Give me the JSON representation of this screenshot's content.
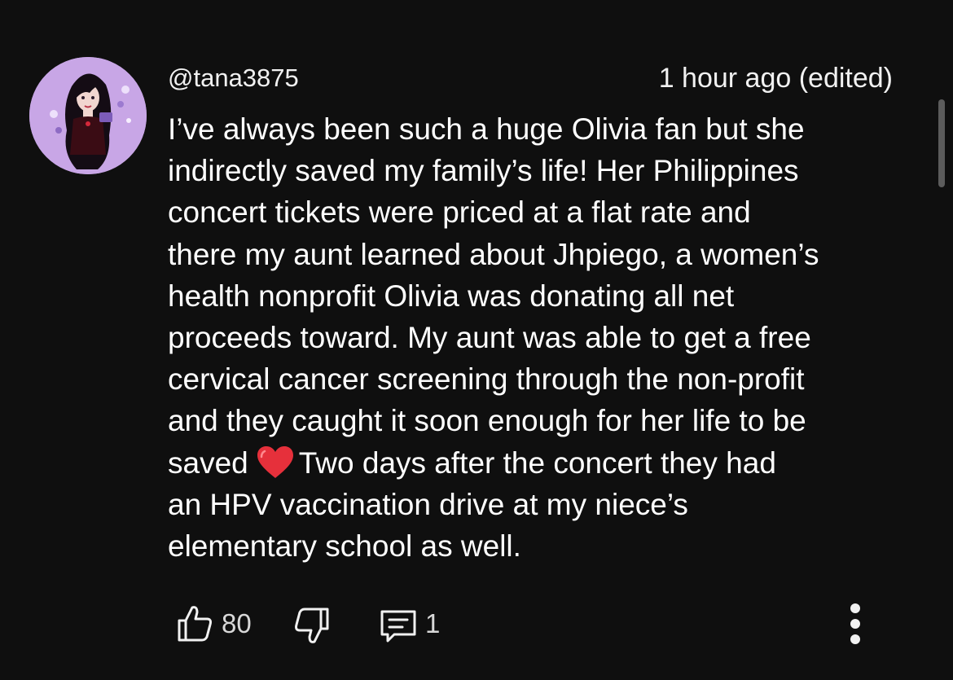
{
  "comment": {
    "author": "@tana3875",
    "timestamp": "1 hour ago (edited)",
    "lines": [
      "I’ve always been such a huge Olivia fan but she",
      "indirectly saved my family’s life! Her Philippines",
      "concert tickets were priced at a flat rate and",
      "there my aunt learned about Jhpiego, a women’s",
      "health nonprofit Olivia was donating all net",
      "proceeds toward. My aunt was able to get a free",
      "cervical cancer screening through the non-profit",
      "and they caught it soon enough for her life to be"
    ],
    "line_with_emoji": {
      "before": "saved",
      "emoji": "heart-emoji",
      "after": "Two days after the concert they had"
    },
    "lines_after": [
      "an HPV vaccination drive at my niece’s",
      "elementary school as well."
    ]
  },
  "actions": {
    "like_icon": "thumbs-up-icon",
    "like_count": "80",
    "dislike_icon": "thumbs-down-icon",
    "reply_icon": "comment-icon",
    "reply_count": "1",
    "more_icon": "more-vertical-icon"
  },
  "colors": {
    "background": "#0f0f0f",
    "text": "#ffffff",
    "secondary_text": "#d8d8d8",
    "avatar_bg": "#c8a6e6",
    "heart": "#e6303b"
  }
}
